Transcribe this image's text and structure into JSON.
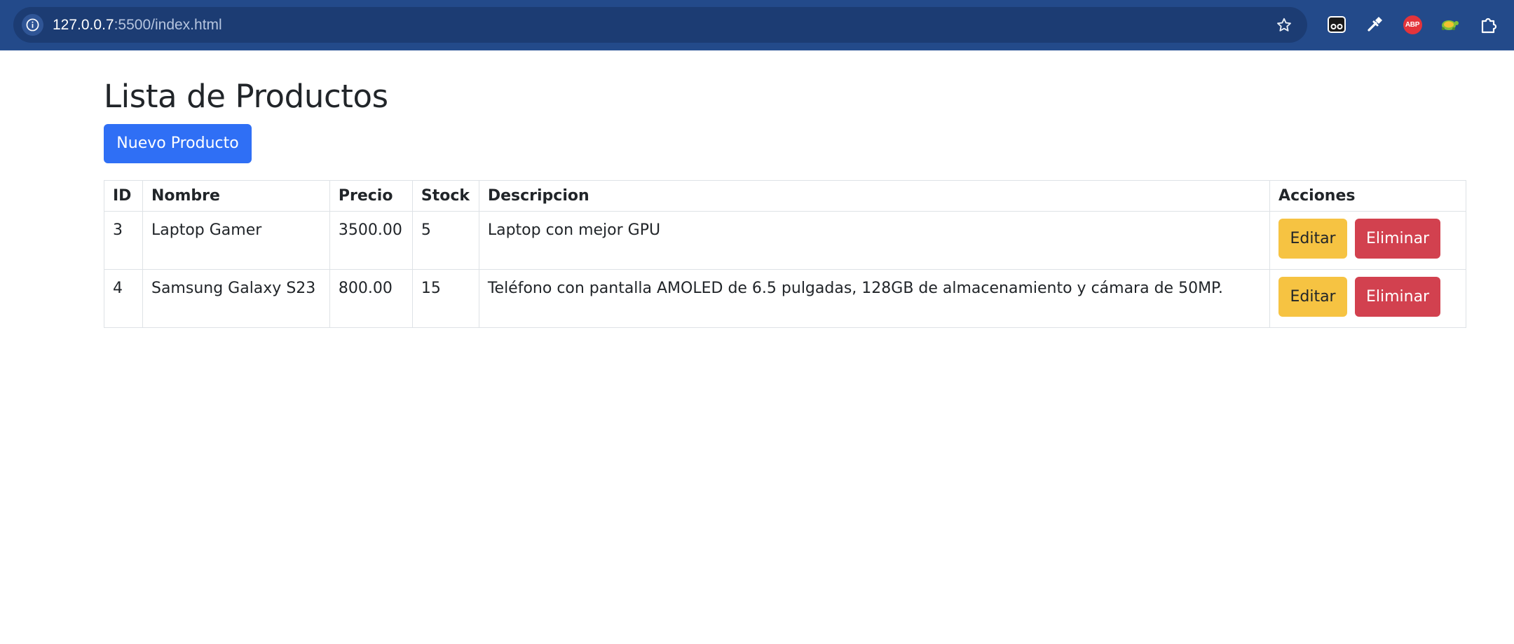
{
  "browser": {
    "url_host": "127.0.0.7",
    "url_rest": ":5500/index.html",
    "icons": [
      "info-icon",
      "star-icon",
      "glasses-extension-icon",
      "eyedropper-extension-icon",
      "adblock-plus-icon",
      "turtle-extension-icon",
      "extensions-puzzle-icon"
    ],
    "abp_label": "ABP",
    "accent": "#234a8a"
  },
  "page": {
    "title": "Lista de Productos",
    "new_button": "Nuevo Producto",
    "colors": {
      "primary": "#2f6ff5",
      "warning": "#f6c342",
      "danger": "#d2414f"
    }
  },
  "table": {
    "headers": [
      "ID",
      "Nombre",
      "Precio",
      "Stock",
      "Descripcion",
      "Acciones"
    ],
    "rows": [
      {
        "id": "3",
        "nombre": "Laptop Gamer",
        "precio": "3500.00",
        "stock": "5",
        "descripcion": "Laptop con mejor GPU",
        "edit_label": "Editar",
        "delete_label": "Eliminar"
      },
      {
        "id": "4",
        "nombre": "Samsung Galaxy S23",
        "precio": "800.00",
        "stock": "15",
        "descripcion": "Teléfono con pantalla AMOLED de 6.5 pulgadas, 128GB de almacenamiento y cámara de 50MP.",
        "edit_label": "Editar",
        "delete_label": "Eliminar"
      }
    ]
  }
}
